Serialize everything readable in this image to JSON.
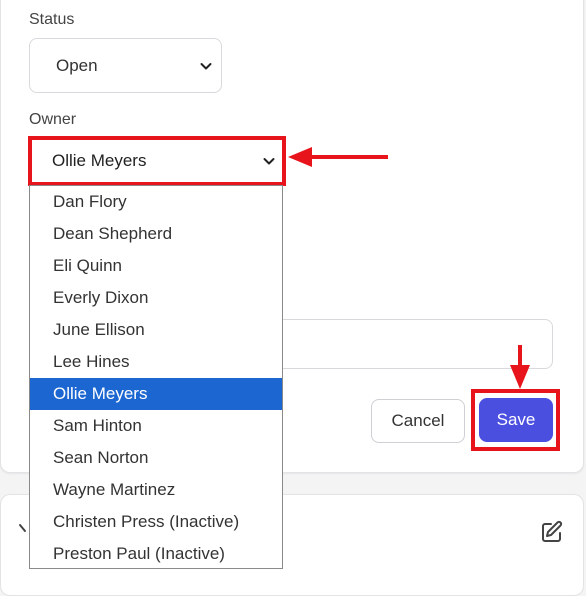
{
  "status": {
    "label": "Status",
    "value": "Open"
  },
  "owner": {
    "label": "Owner",
    "value": "Ollie Meyers",
    "options": [
      "Dan Flory",
      "Dean Shepherd",
      "Eli Quinn",
      "Everly Dixon",
      "June Ellison",
      "Lee Hines",
      "Ollie Meyers",
      "Sam Hinton",
      "Sean Norton",
      "Wayne Martinez",
      "Christen Press (Inactive)",
      "Preston Paul (Inactive)"
    ],
    "selected_option": "Ollie Meyers"
  },
  "actions": {
    "cancel_label": "Cancel",
    "save_label": "Save"
  },
  "colors": {
    "highlight_red": "#e8141b",
    "save_button": "#4b4fe0",
    "selected_option": "#1b66d1"
  },
  "icons": {
    "dropdown": "chevron-down-icon",
    "edit": "edit-icon",
    "collapse": "chevron-icon"
  }
}
